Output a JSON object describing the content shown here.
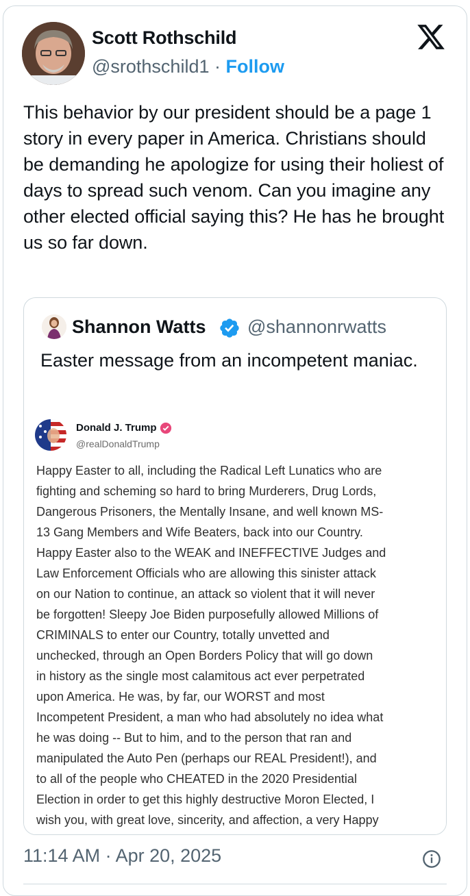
{
  "author": {
    "name": "Scott Rothschild",
    "handle": "@srothschild1",
    "separator": " · ",
    "follow_label": "Follow"
  },
  "tweet_text": "This behavior by our president should be a page 1 story in every paper in America. Christians should be demanding he apologize for using their holiest of days to spread such venom. Can you imagine any other elected official saying this? He has he brought us so far down.",
  "quote": {
    "name": "Shannon Watts",
    "handle": "@shannonrwatts",
    "text": "Easter message from an incompetent maniac.",
    "screenshot": {
      "name": "Donald J. Trump",
      "handle": "@realDonaldTrump",
      "lines": [
        "Happy Easter to all, including the Radical Left Lunatics who are",
        "fighting and scheming so hard to bring Murderers, Drug Lords,",
        "Dangerous Prisoners, the Mentally Insane, and well known MS-",
        "13 Gang Members and Wife Beaters, back into our Country.",
        "Happy Easter also to the WEAK and INEFFECTIVE Judges and",
        "Law Enforcement Officials who are allowing this sinister attack",
        "on our Nation to continue, an attack so violent that it will never",
        "be forgotten! Sleepy Joe Biden purposefully allowed Millions of",
        "CRIMINALS to enter our Country, totally unvetted and",
        "unchecked, through an Open Borders Policy that will go down",
        "in history as the single most calamitous act ever perpetrated",
        "upon America. He was, by far, our WORST and most",
        "Incompetent President, a man who had absolutely no idea what",
        "he was doing -- But to him, and to the person that ran and",
        "manipulated the Auto Pen (perhaps our REAL President!), and",
        "to all of the people who CHEATED in the 2020 Presidential",
        "Election in order to get this highly destructive Moron Elected, I",
        "wish you, with great love, sincerity, and affection, a very Happy"
      ]
    }
  },
  "timestamp": "11:14 AM · Apr 20, 2025",
  "icons": {
    "logo": "x-logo-icon",
    "verified": "verified-badge-icon",
    "info": "info-icon"
  },
  "colors": {
    "accent": "#1d9bf0",
    "secondary_text": "#536471",
    "truth_badge": "#e8477a"
  }
}
